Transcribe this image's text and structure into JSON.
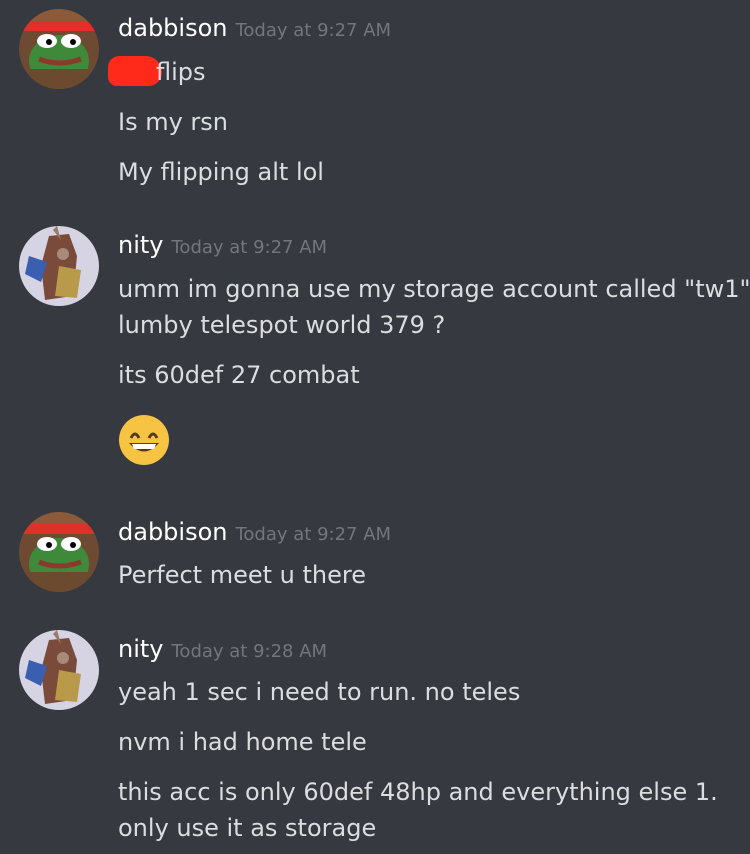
{
  "messages": [
    {
      "username": "dabbison",
      "timestamp": "Today at 9:27 AM",
      "avatar_icon": "pepe-frog-red-headband-avatar",
      "lines": [
        "flips",
        "Is my rsn",
        "My flipping alt lol"
      ]
    },
    {
      "username": "nity",
      "timestamp": "Today at 9:27 AM",
      "avatar_icon": "armored-warrior-avatar",
      "lines": [
        "umm im gonna use my storage account called \"tw1\"",
        "lumby telespot world 379 ?",
        "its 60def 27 combat"
      ],
      "emoji": "grinning-face-icon"
    },
    {
      "username": "dabbison",
      "timestamp": "Today at 9:27 AM",
      "avatar_icon": "pepe-frog-red-headband-avatar",
      "lines": [
        "Perfect meet u there"
      ]
    },
    {
      "username": "nity",
      "timestamp": "Today at 9:28 AM",
      "avatar_icon": "armored-warrior-avatar",
      "lines": [
        "yeah 1 sec i need to run. no teles",
        "nvm i had home tele",
        "this acc is only 60def 48hp and everything else 1.",
        "only use it as storage"
      ]
    }
  ],
  "colors": {
    "background": "#36393f",
    "username": "#ffffff",
    "timestamp": "#72767d",
    "message_text": "#dcddde",
    "redaction": "#ff2a1a"
  }
}
